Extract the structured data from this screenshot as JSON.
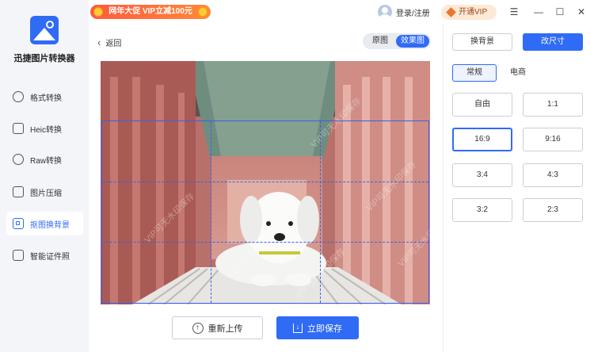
{
  "app": {
    "name": "迅捷图片转换器"
  },
  "titlebar": {
    "promo": "网年大促 VIP立减100元",
    "login": "登录/注册",
    "vip": "开通VIP",
    "menu_glyph": "☰",
    "minimize_glyph": "—",
    "maximize_glyph": "☐",
    "close_glyph": "✕"
  },
  "sidebar": {
    "items": [
      {
        "label": "格式转换"
      },
      {
        "label": "Heic转换"
      },
      {
        "label": "Raw转换"
      },
      {
        "label": "图片压缩"
      },
      {
        "label": "抠图换背景"
      },
      {
        "label": "智能证件照"
      }
    ],
    "active": "抠图换背景"
  },
  "main": {
    "back": "返回",
    "back_glyph": "‹",
    "view_toggle": {
      "original": "原图",
      "effect": "效果图",
      "selected": "效果图"
    },
    "watermark": "VIP可无水印保存",
    "reupload": "重新上传",
    "save": "立即保存"
  },
  "panel": {
    "tabs": {
      "background": "换背景",
      "resize": "改尺寸",
      "active": "改尺寸"
    },
    "subtabs": {
      "normal": "常规",
      "ecommerce": "电商",
      "active": "常规"
    },
    "ratios": [
      "自由",
      "1:1",
      "16:9",
      "9:16",
      "3:4",
      "4:3",
      "3:2",
      "2:3"
    ],
    "selected_ratio": "16:9"
  },
  "colors": {
    "accent": "#2f6bf5",
    "promo": "#ff5a3c",
    "vip_bg": "#fde9d6"
  }
}
